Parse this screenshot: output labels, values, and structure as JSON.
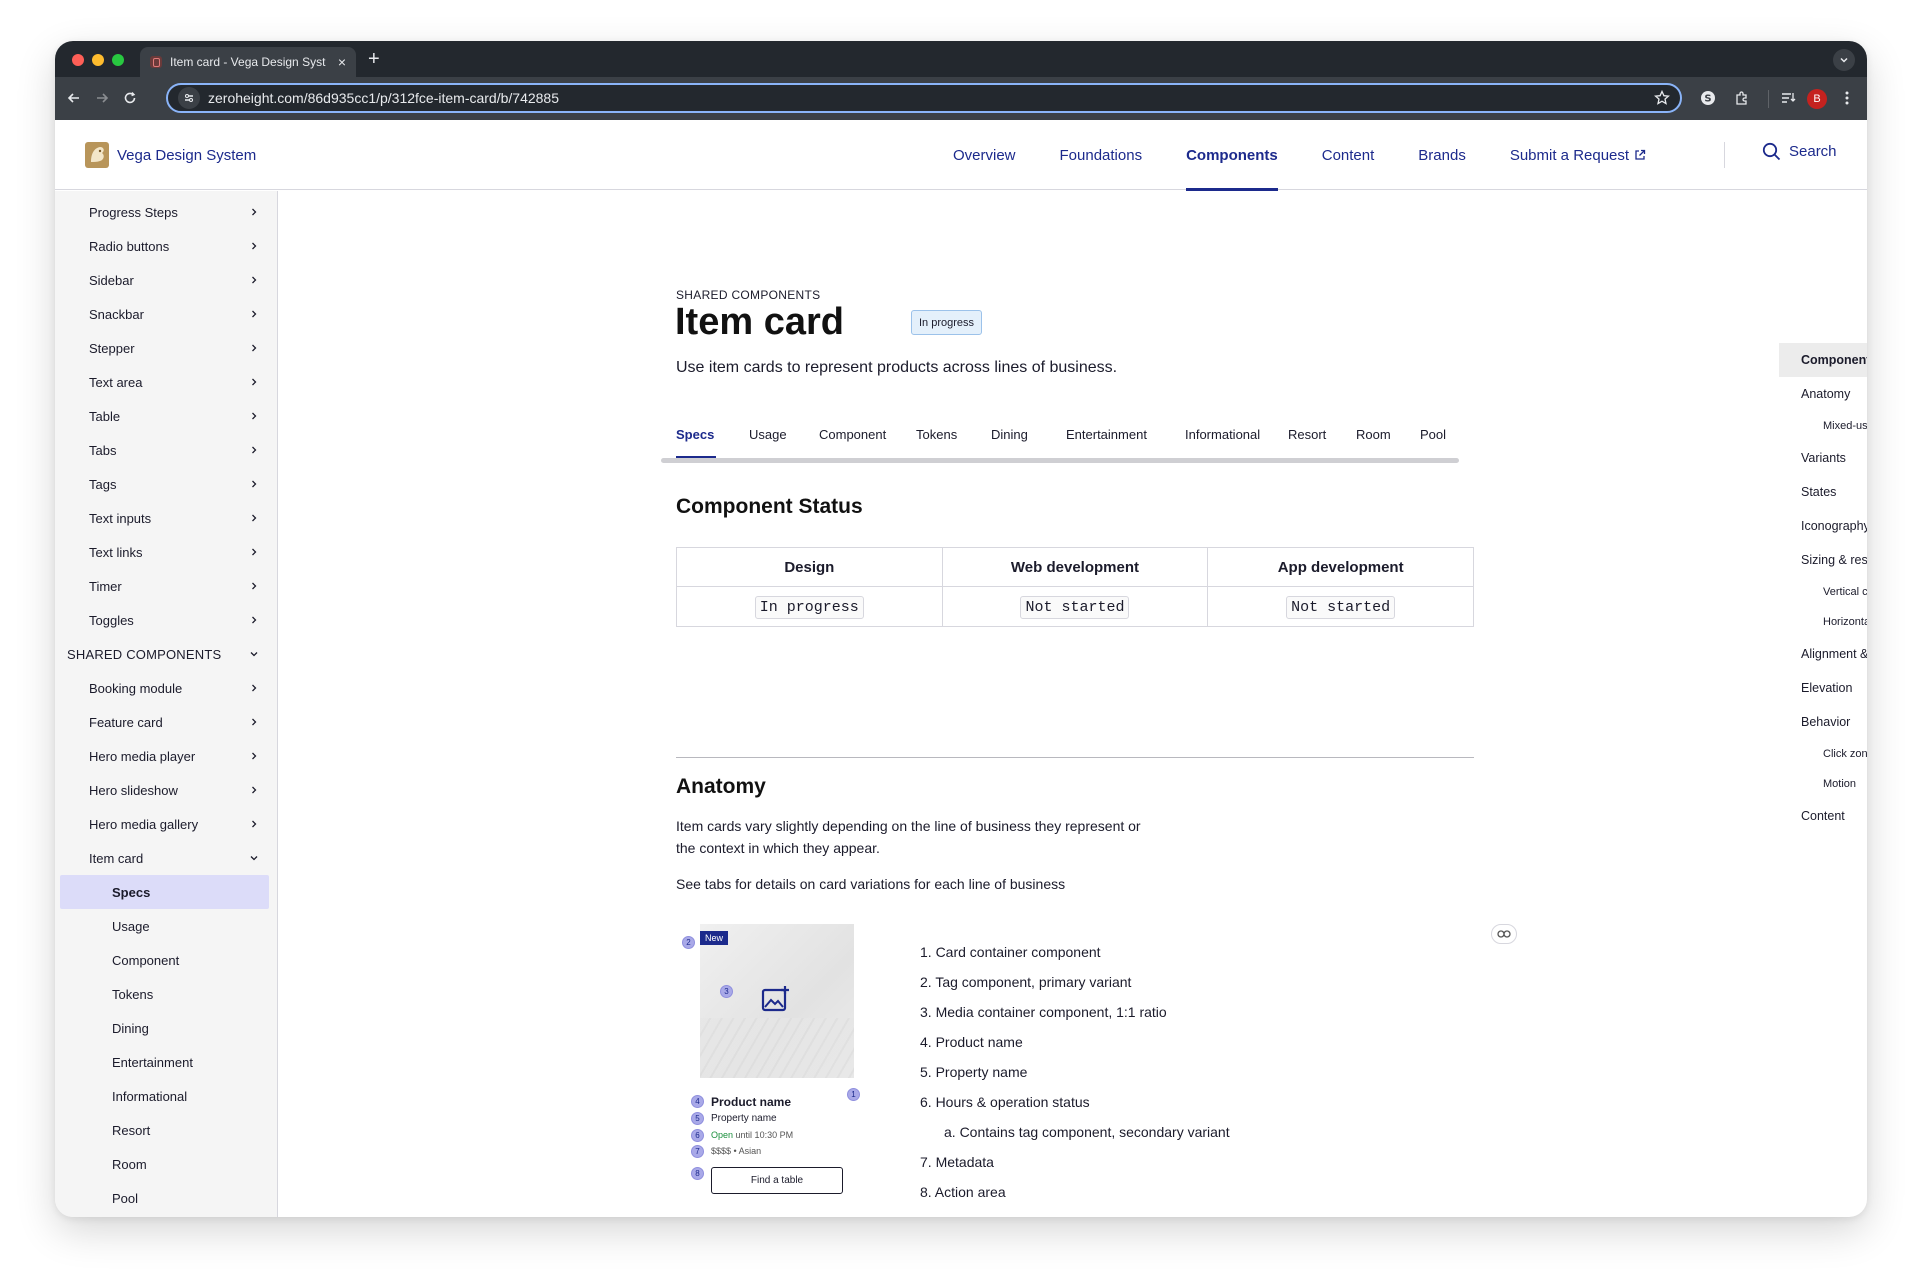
{
  "browser": {
    "tab_title": "Item card - Vega Design Syst",
    "url": "zeroheight.com/86d935cc1/p/312fce-item-card/b/742885",
    "profile_initial": "B"
  },
  "header": {
    "logo_text": "Vega Design System",
    "nav": [
      "Overview",
      "Foundations",
      "Components",
      "Content",
      "Brands",
      "Submit a Request"
    ],
    "active_nav": "Components",
    "search_label": "Search"
  },
  "sidebar": {
    "items_top": [
      "Progress Steps",
      "Radio buttons",
      "Sidebar",
      "Snackbar",
      "Stepper",
      "Text area",
      "Table",
      "Tabs",
      "Tags",
      "Text inputs",
      "Text links",
      "Timer",
      "Toggles"
    ],
    "section": "SHARED COMPONENTS",
    "items_shared": [
      "Booking module",
      "Feature card",
      "Hero media player",
      "Hero slideshow",
      "Hero media gallery",
      "Item card"
    ],
    "subitems": [
      "Specs",
      "Usage",
      "Component",
      "Tokens",
      "Dining",
      "Entertainment",
      "Informational",
      "Resort",
      "Room",
      "Pool"
    ],
    "active_sub": "Specs"
  },
  "page": {
    "eyebrow": "SHARED COMPONENTS",
    "title": "Item card",
    "status": "In progress",
    "lead": "Use item cards to represent products across lines of business.",
    "tabs": [
      "Specs",
      "Usage",
      "Component",
      "Tokens",
      "Dining",
      "Entertainment",
      "Informational",
      "Resort",
      "Room",
      "Pool"
    ],
    "active_tab": "Specs"
  },
  "status_section": {
    "heading": "Component Status",
    "columns": [
      "Design",
      "Web development",
      "App development"
    ],
    "values": [
      "In progress",
      "Not started",
      "Not started"
    ]
  },
  "anatomy": {
    "heading": "Anatomy",
    "para1_line1": "Item cards vary slightly depending on the line of business they represent or",
    "para1_line2": "the context in which they appear.",
    "para2": "See tabs for details on card variations for each line of business",
    "card": {
      "tag": "New",
      "product_name": "Product name",
      "property_name": "Property name",
      "open": "Open",
      "hours": "until 10:30 PM",
      "metadata": "$$$$ • Asian",
      "action": "Find a table",
      "markers": [
        "1",
        "2",
        "3",
        "4",
        "5",
        "6",
        "7",
        "8"
      ]
    },
    "list": [
      "1. Card container component",
      "2. Tag component, primary variant",
      "3. Media container component, 1:1 ratio",
      "4. Product name",
      "5. Property name",
      "6. Hours & operation status",
      "a. Contains tag component, secondary variant",
      "7. Metadata",
      "8. Action area"
    ]
  },
  "toc": {
    "items": [
      {
        "label": "Component Status",
        "level": 1
      },
      {
        "label": "Anatomy",
        "level": 1
      },
      {
        "label": "Mixed-use scenarios",
        "level": 2
      },
      {
        "label": "Variants",
        "level": 1
      },
      {
        "label": "States",
        "level": 1
      },
      {
        "label": "Iconography",
        "level": 1
      },
      {
        "label": "Sizing & responsiveness",
        "level": 1
      },
      {
        "label": "Vertical card",
        "level": 2
      },
      {
        "label": "Horizontal card",
        "level": 2
      },
      {
        "label": "Alignment & spacing",
        "level": 1
      },
      {
        "label": "Elevation",
        "level": 1
      },
      {
        "label": "Behavior",
        "level": 1
      },
      {
        "label": "Click zones",
        "level": 2
      },
      {
        "label": "Motion",
        "level": 2
      },
      {
        "label": "Content",
        "level": 1
      }
    ]
  },
  "colors": {
    "brand": "#1c2a8c",
    "active_sidebar": "#dcdcf9",
    "chrome_dark": "#23282e",
    "chrome_toolbar": "#3b4046",
    "status_pill_bg": "#e4f0fb"
  }
}
